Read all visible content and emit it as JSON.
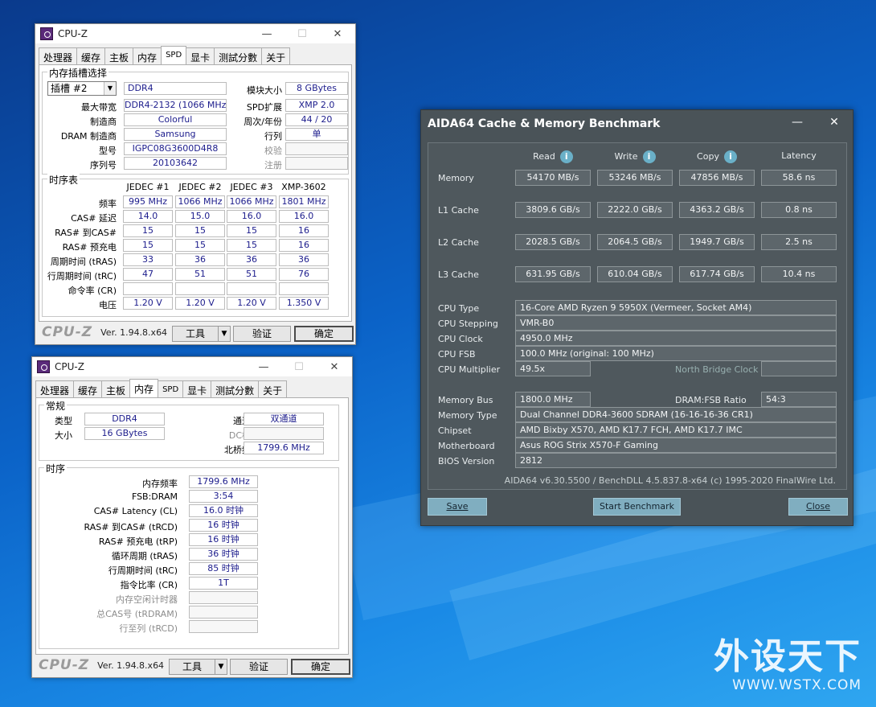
{
  "cpuz1": {
    "title": "CPU-Z",
    "tabs": [
      "处理器",
      "缓存",
      "主板",
      "内存",
      "SPD",
      "显卡",
      "测試分數",
      "关于"
    ],
    "active_tab": 4,
    "slot_group": "内存插槽选择",
    "slot": "插槽 #2",
    "type": "DDR4",
    "rows": [
      {
        "label": "最大带宽",
        "value": "DDR4-2132 (1066 MHz)",
        "label2": "SPD扩展",
        "value2": "XMP 2.0"
      },
      {
        "label": "制造商",
        "value": "Colorful",
        "label2": "周次/年份",
        "value2": "44 / 20"
      },
      {
        "label": "DRAM 制造商",
        "value": "Samsung",
        "label2": "行列",
        "value2": "单"
      },
      {
        "label": "型号",
        "value": "IGPC08G3600D4R8",
        "label2": "校验",
        "value2": ""
      },
      {
        "label": "序列号",
        "value": "20103642",
        "label2": "注册",
        "value2": ""
      }
    ],
    "module_size_label": "模块大小",
    "module_size": "8 GBytes",
    "timing_group": "时序表",
    "columns": [
      "JEDEC #1",
      "JEDEC #2",
      "JEDEC #3",
      "XMP-3602"
    ],
    "timing_rows": [
      {
        "label": "频率",
        "values": [
          "995 MHz",
          "1066 MHz",
          "1066 MHz",
          "1801 MHz"
        ]
      },
      {
        "label": "CAS# 延迟",
        "values": [
          "14.0",
          "15.0",
          "16.0",
          "16.0"
        ]
      },
      {
        "label": "RAS# 到CAS#",
        "values": [
          "15",
          "15",
          "15",
          "16"
        ]
      },
      {
        "label": "RAS# 预充电",
        "values": [
          "15",
          "15",
          "15",
          "16"
        ]
      },
      {
        "label": "周期时间 (tRAS)",
        "values": [
          "33",
          "36",
          "36",
          "36"
        ]
      },
      {
        "label": "行周期时间 (tRC)",
        "values": [
          "47",
          "51",
          "51",
          "76"
        ]
      },
      {
        "label": "命令率 (CR)",
        "values": [
          "",
          "",
          "",
          ""
        ]
      },
      {
        "label": "电压",
        "values": [
          "1.20 V",
          "1.20 V",
          "1.20 V",
          "1.350 V"
        ]
      }
    ],
    "brand": "CPU-Z",
    "version": "Ver. 1.94.8.x64",
    "tools": "工具",
    "validate": "验证",
    "ok": "确定"
  },
  "cpuz2": {
    "title": "CPU-Z",
    "tabs": [
      "处理器",
      "缓存",
      "主板",
      "内存",
      "SPD",
      "显卡",
      "测試分數",
      "关于"
    ],
    "active_tab": 3,
    "general_group": "常规",
    "type_label": "类型",
    "type": "DDR4",
    "channels_label": "通道数",
    "channels": "双通道",
    "size_label": "大小",
    "size": "16 GBytes",
    "dc_label": "DC模式",
    "dc": "",
    "nb_label": "北桥频率",
    "nb": "1799.6 MHz",
    "timing_group": "时序",
    "timing_rows": [
      {
        "label": "内存频率",
        "value": "1799.6 MHz",
        "gray": false
      },
      {
        "label": "FSB:DRAM",
        "value": "3:54",
        "gray": false
      },
      {
        "label": "CAS# Latency (CL)",
        "value": "16.0 时钟",
        "gray": false
      },
      {
        "label": "RAS# 到CAS# (tRCD)",
        "value": "16 时钟",
        "gray": false
      },
      {
        "label": "RAS# 预充电 (tRP)",
        "value": "16 时钟",
        "gray": false
      },
      {
        "label": "循环周期 (tRAS)",
        "value": "36 时钟",
        "gray": false
      },
      {
        "label": "行周期时间 (tRC)",
        "value": "85 时钟",
        "gray": false
      },
      {
        "label": "指令比率 (CR)",
        "value": "1T",
        "gray": false
      },
      {
        "label": "内存空闲计时器",
        "value": "",
        "gray": true
      },
      {
        "label": "总CAS号 (tRDRAM)",
        "value": "",
        "gray": true
      },
      {
        "label": "行至列 (tRCD)",
        "value": "",
        "gray": true
      }
    ],
    "brand": "CPU-Z",
    "version": "Ver. 1.94.8.x64",
    "tools": "工具",
    "validate": "验证",
    "ok": "确定"
  },
  "aida": {
    "title": "AIDA64 Cache & Memory Benchmark",
    "headers": [
      "Read",
      "Write",
      "Copy",
      "Latency"
    ],
    "bench": [
      {
        "label": "Memory",
        "values": [
          "54170 MB/s",
          "53246 MB/s",
          "47856 MB/s",
          "58.6 ns"
        ]
      },
      {
        "label": "L1 Cache",
        "values": [
          "3809.6 GB/s",
          "2222.0 GB/s",
          "4363.2 GB/s",
          "0.8 ns"
        ]
      },
      {
        "label": "L2 Cache",
        "values": [
          "2028.5 GB/s",
          "2064.5 GB/s",
          "1949.7 GB/s",
          "2.5 ns"
        ]
      },
      {
        "label": "L3 Cache",
        "values": [
          "631.95 GB/s",
          "610.04 GB/s",
          "617.74 GB/s",
          "10.4 ns"
        ]
      }
    ],
    "cpu": [
      {
        "label": "CPU Type",
        "value": "16-Core AMD Ryzen 9 5950X  (Vermeer, Socket AM4)"
      },
      {
        "label": "CPU Stepping",
        "value": "VMR-B0"
      },
      {
        "label": "CPU Clock",
        "value": "4950.0 MHz"
      },
      {
        "label": "CPU FSB",
        "value": "100.0 MHz  (original: 100 MHz)"
      }
    ],
    "multiplier_label": "CPU Multiplier",
    "multiplier": "49.5x",
    "nb_clock_label": "North Bridge Clock",
    "nb_clock": "",
    "membus_label": "Memory Bus",
    "membus": "1800.0 MHz",
    "ratio_label": "DRAM:FSB Ratio",
    "ratio": "54:3",
    "sys": [
      {
        "label": "Memory Type",
        "value": "Dual Channel DDR4-3600 SDRAM  (16-16-16-36 CR1)"
      },
      {
        "label": "Chipset",
        "value": "AMD Bixby X570, AMD K17.7 FCH, AMD K17.7 IMC"
      },
      {
        "label": "Motherboard",
        "value": "Asus ROG Strix X570-F Gaming"
      },
      {
        "label": "BIOS Version",
        "value": "2812"
      }
    ],
    "footer": "AIDA64 v6.30.5500 / BenchDLL 4.5.837.8-x64  (c) 1995-2020 FinalWire Ltd.",
    "save": "Save",
    "start": "Start Benchmark",
    "close": "Close"
  },
  "watermark": {
    "text": "外设天下",
    "url": "WWW.WSTX.COM"
  }
}
